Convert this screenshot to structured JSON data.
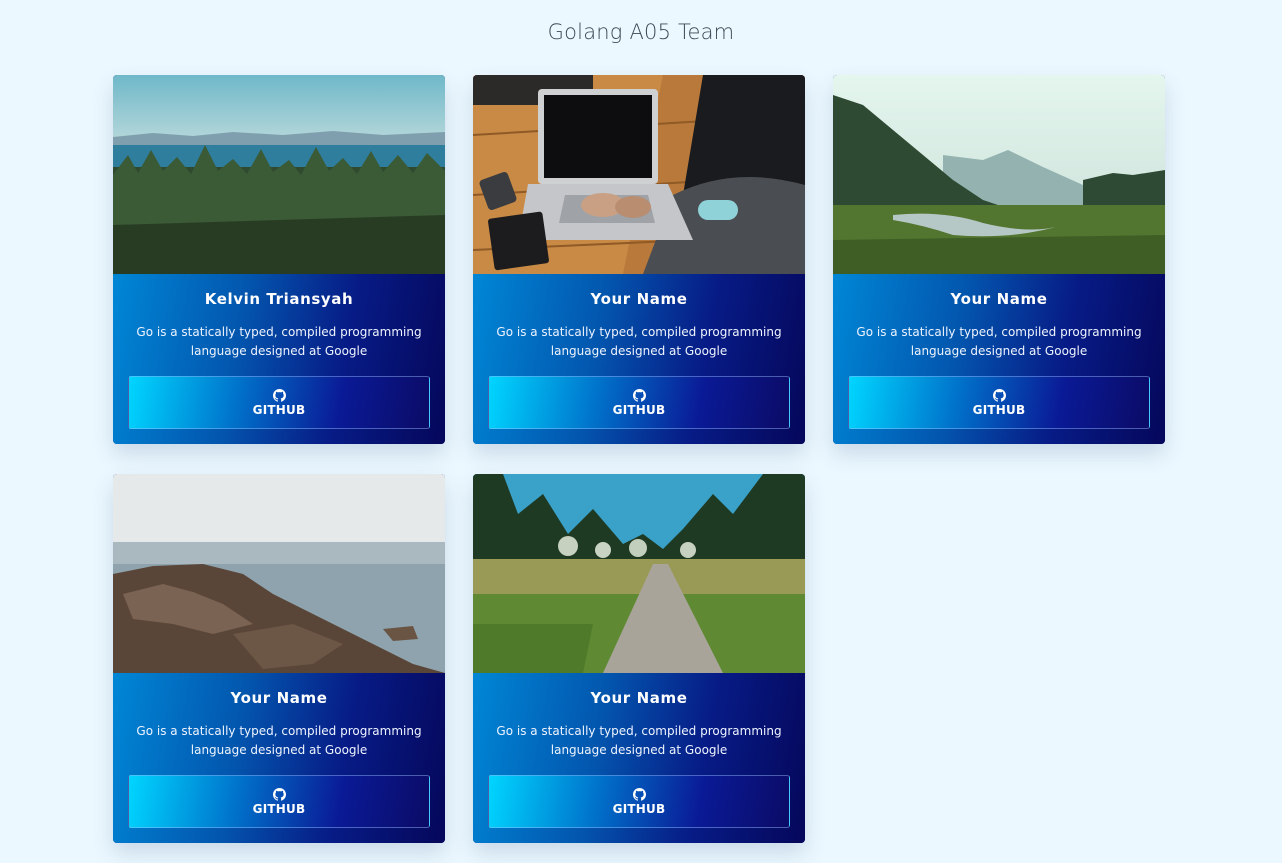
{
  "page": {
    "title": "Golang A05 Team"
  },
  "cards": [
    {
      "name": "Kelvin Triansyah",
      "description": "Go is a statically typed, compiled programming language designed at Google",
      "button_label": "GITHUB",
      "button_icon": "github-icon",
      "image": "forest-lake-photo"
    },
    {
      "name": "Your Name",
      "description": "Go is a statically typed, compiled programming language designed at Google",
      "button_label": "GITHUB",
      "button_icon": "github-icon",
      "image": "laptop-desk-photo"
    },
    {
      "name": "Your Name",
      "description": "Go is a statically typed, compiled programming language designed at Google",
      "button_label": "GITHUB",
      "button_icon": "github-icon",
      "image": "river-valley-photo"
    },
    {
      "name": "Your Name",
      "description": "Go is a statically typed, compiled programming language designed at Google",
      "button_label": "GITHUB",
      "button_icon": "github-icon",
      "image": "rocky-shore-photo"
    },
    {
      "name": "Your Name",
      "description": "Go is a statically typed, compiled programming language designed at Google",
      "button_label": "GITHUB",
      "button_icon": "github-icon",
      "image": "meadow-path-photo"
    }
  ],
  "colors": {
    "background": "#ecf8ff",
    "card_gradient_start": "#0087d6",
    "card_gradient_end": "#05075a",
    "button_gradient_start": "#00d6ff"
  }
}
